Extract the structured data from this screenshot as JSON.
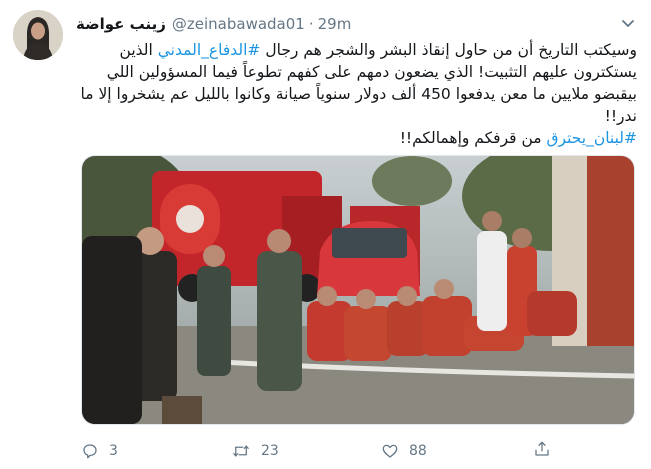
{
  "tweet": {
    "display_name": "زينب عواضة",
    "handle": "@zeinabawada01",
    "separator": "·",
    "time": "29m",
    "text": {
      "line1_a": "وسيكتب التاريخ أن من حاول إنقاذ البشر والشجر هم رجال ",
      "hashtag1": "#الدفاع_المدني",
      "line1_b": " الذين يستكترون عليهم التثبيت! الذي يضعون دمهم على كفهم تطوعاً فيما المسؤولين اللي بيقبضو ملايين ما معن يدفعوا 450 ألف دولار سنوياً صيانة وكانوا بالليل عم يشخروا إلا ما ندر!!",
      "hashtag2": "#لبنان_يحترق",
      "line2": " من قرفكم وإهمالكم!!"
    },
    "image_alt_icon": "photo-firefighters-resting"
  },
  "actions": {
    "reply_icon": "reply-icon",
    "reply_count": "3",
    "retweet_icon": "retweet-icon",
    "retweet_count": "23",
    "like_icon": "heart-icon",
    "like_count": "88",
    "share_icon": "share-icon"
  },
  "colors": {
    "link": "#1b95e0",
    "muted": "#657786",
    "text": "#14171a"
  }
}
